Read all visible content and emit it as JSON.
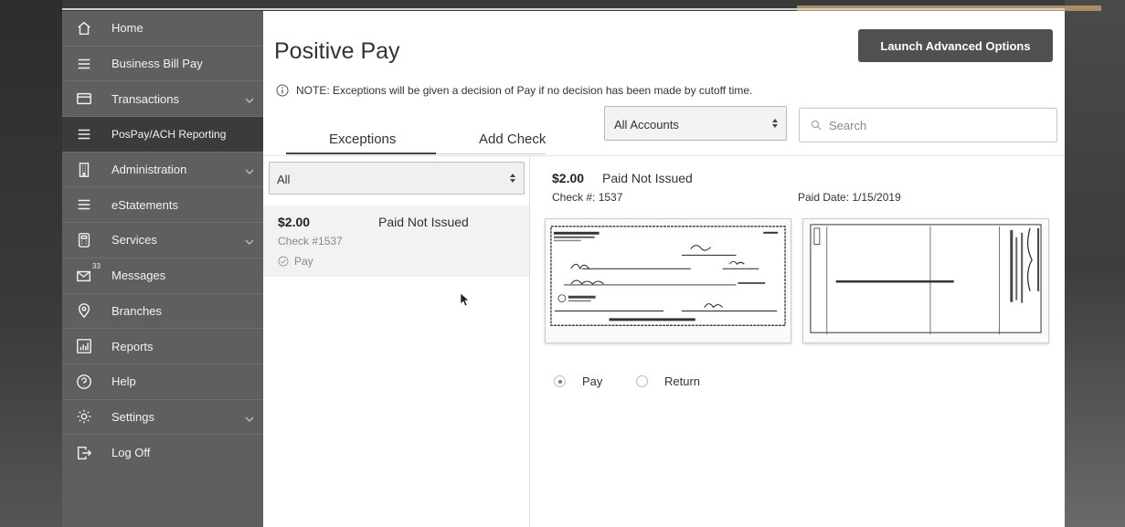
{
  "sidebar": {
    "items": [
      {
        "label": "Home",
        "icon": "home-icon",
        "chevron": false,
        "active": false
      },
      {
        "label": "Business Bill Pay",
        "icon": "menu-icon",
        "chevron": false,
        "active": false
      },
      {
        "label": "Transactions",
        "icon": "card-icon",
        "chevron": true,
        "active": false
      },
      {
        "label": "PosPay/ACH Reporting",
        "icon": "menu-icon",
        "chevron": false,
        "active": true
      },
      {
        "label": "Administration",
        "icon": "building-icon",
        "chevron": true,
        "active": false
      },
      {
        "label": "eStatements",
        "icon": "menu-icon",
        "chevron": false,
        "active": false
      },
      {
        "label": "Services",
        "icon": "calculator-icon",
        "chevron": true,
        "active": false
      },
      {
        "label": "Messages",
        "icon": "envelope-icon",
        "chevron": false,
        "active": false,
        "badge": "33"
      },
      {
        "label": "Branches",
        "icon": "location-pin-icon",
        "chevron": false,
        "active": false
      },
      {
        "label": "Reports",
        "icon": "bar-chart-icon",
        "chevron": false,
        "active": false
      },
      {
        "label": "Help",
        "icon": "help-icon",
        "chevron": false,
        "active": false
      },
      {
        "label": "Settings",
        "icon": "gear-icon",
        "chevron": true,
        "active": false
      },
      {
        "label": "Log Off",
        "icon": "logout-icon",
        "chevron": false,
        "active": false
      }
    ]
  },
  "header": {
    "title": "Positive Pay",
    "launch_button": "Launch Advanced Options",
    "note": "NOTE: Exceptions will be given a decision of Pay if no decision has been made by cutoff time."
  },
  "tabs": {
    "exceptions": "Exceptions",
    "add_check": "Add Check"
  },
  "filters": {
    "accounts_selected": "All Accounts",
    "search_placeholder": "Search",
    "list_filter": "All"
  },
  "exception_list": [
    {
      "amount": "$2.00",
      "status": "Paid Not Issued",
      "check": "Check #1537",
      "decision": "Pay"
    }
  ],
  "detail": {
    "amount": "$2.00",
    "status": "Paid Not Issued",
    "check_number": "Check #: 1537",
    "paid_date": "Paid Date: 1/15/2019",
    "decision_options": {
      "pay": "Pay",
      "return": "Return"
    },
    "selected_decision": "Pay"
  },
  "colors": {
    "sidebar_bg": "#5f5f5f",
    "sidebar_active": "#3b3b3b",
    "button_bg": "#505050",
    "accent_gold": "#a88e62"
  }
}
